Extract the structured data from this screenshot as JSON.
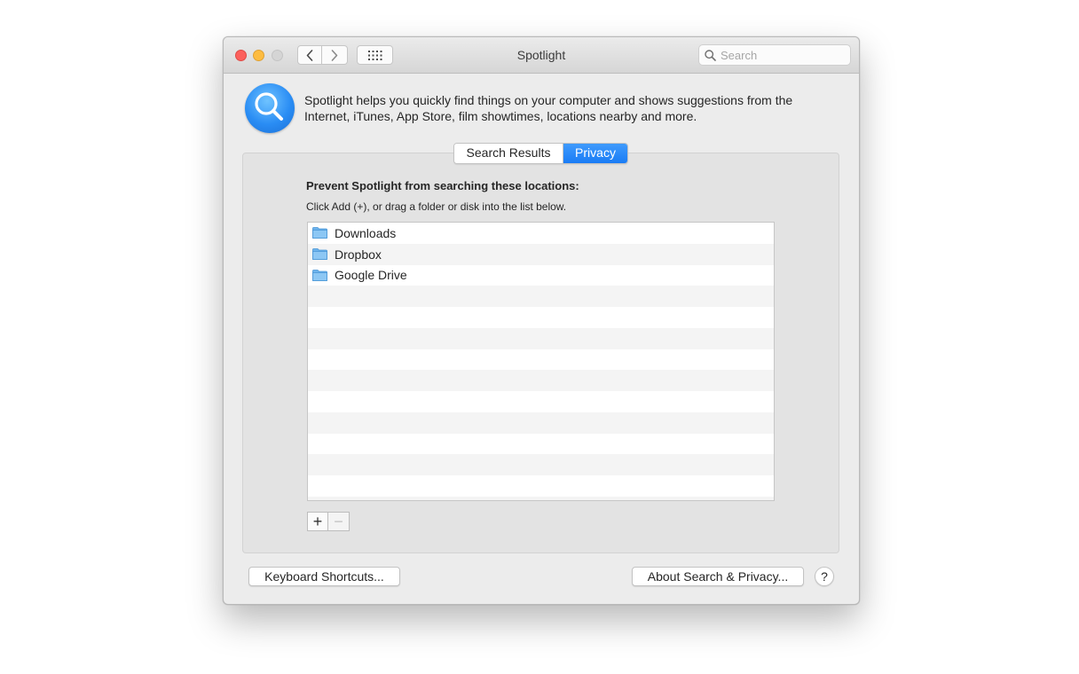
{
  "window": {
    "title": "Spotlight"
  },
  "toolbar": {
    "search_placeholder": "Search",
    "back_icon": "chevron-left-icon",
    "forward_icon": "chevron-right-icon",
    "grid_icon": "grid-icon"
  },
  "header": {
    "icon": "spotlight-magnifier-icon",
    "description": "Spotlight helps you quickly find things on your computer and shows suggestions from the Internet, iTunes, App Store, film showtimes, locations nearby and more."
  },
  "tabs": [
    {
      "label": "Search Results",
      "selected": false
    },
    {
      "label": "Privacy",
      "selected": true
    }
  ],
  "privacy": {
    "title": "Prevent Spotlight from searching these locations:",
    "instructions": "Click Add (+), or drag a folder or disk into the list below.",
    "locations": [
      {
        "name": "Downloads",
        "icon": "folder-icon"
      },
      {
        "name": "Dropbox",
        "icon": "folder-icon"
      },
      {
        "name": "Google Drive",
        "icon": "folder-icon"
      }
    ],
    "add_label": "+",
    "remove_label": "−"
  },
  "footer": {
    "keyboard_shortcuts_label": "Keyboard Shortcuts...",
    "about_label": "About Search & Privacy...",
    "help_label": "?"
  },
  "colors": {
    "accent": "#1a7cf5",
    "close": "#fc605c",
    "minimize": "#fdbc40",
    "zoom_disabled": "#d5d5d5"
  }
}
